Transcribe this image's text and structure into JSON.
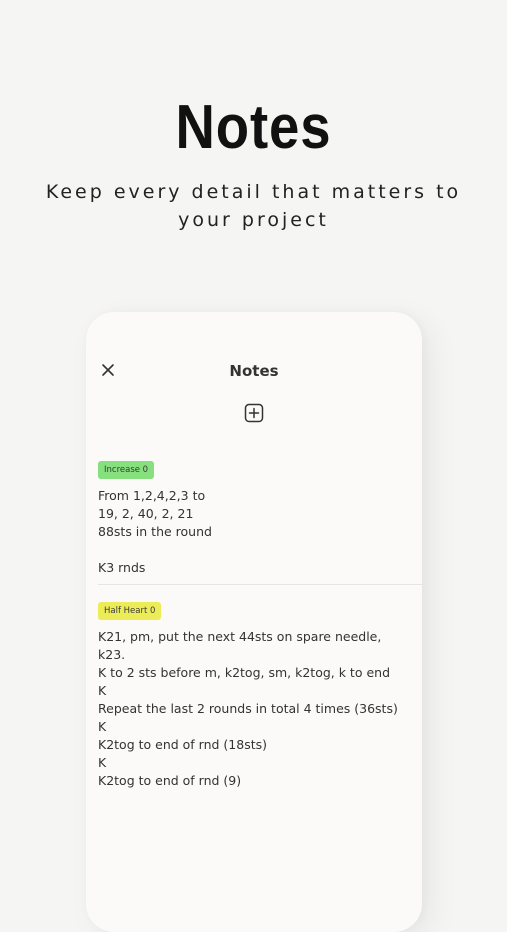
{
  "hero": {
    "title": "Notes",
    "subtitle": "Keep every detail that matters to your project"
  },
  "screen": {
    "title": "Notes",
    "close_icon": "close-icon",
    "add_icon": "plus-square-icon"
  },
  "notes": [
    {
      "tag": "Increase  0",
      "tag_color": "#86e07d",
      "body": "From 1,2,4,2,3 to\n19, 2, 40, 2, 21\n88sts in the round\n\nK3 rnds"
    },
    {
      "tag": "Half Heart 0",
      "tag_color": "#ecec58",
      "body": "K21, pm, put the next 44sts on spare needle, k23.\nK to 2 sts before m, k2tog, sm, k2tog, k to end\nK\nRepeat the last 2 rounds in total 4 times (36sts)\nK\nK2tog to end of rnd (18sts)\nK\nK2tog to end of rnd (9)"
    }
  ]
}
